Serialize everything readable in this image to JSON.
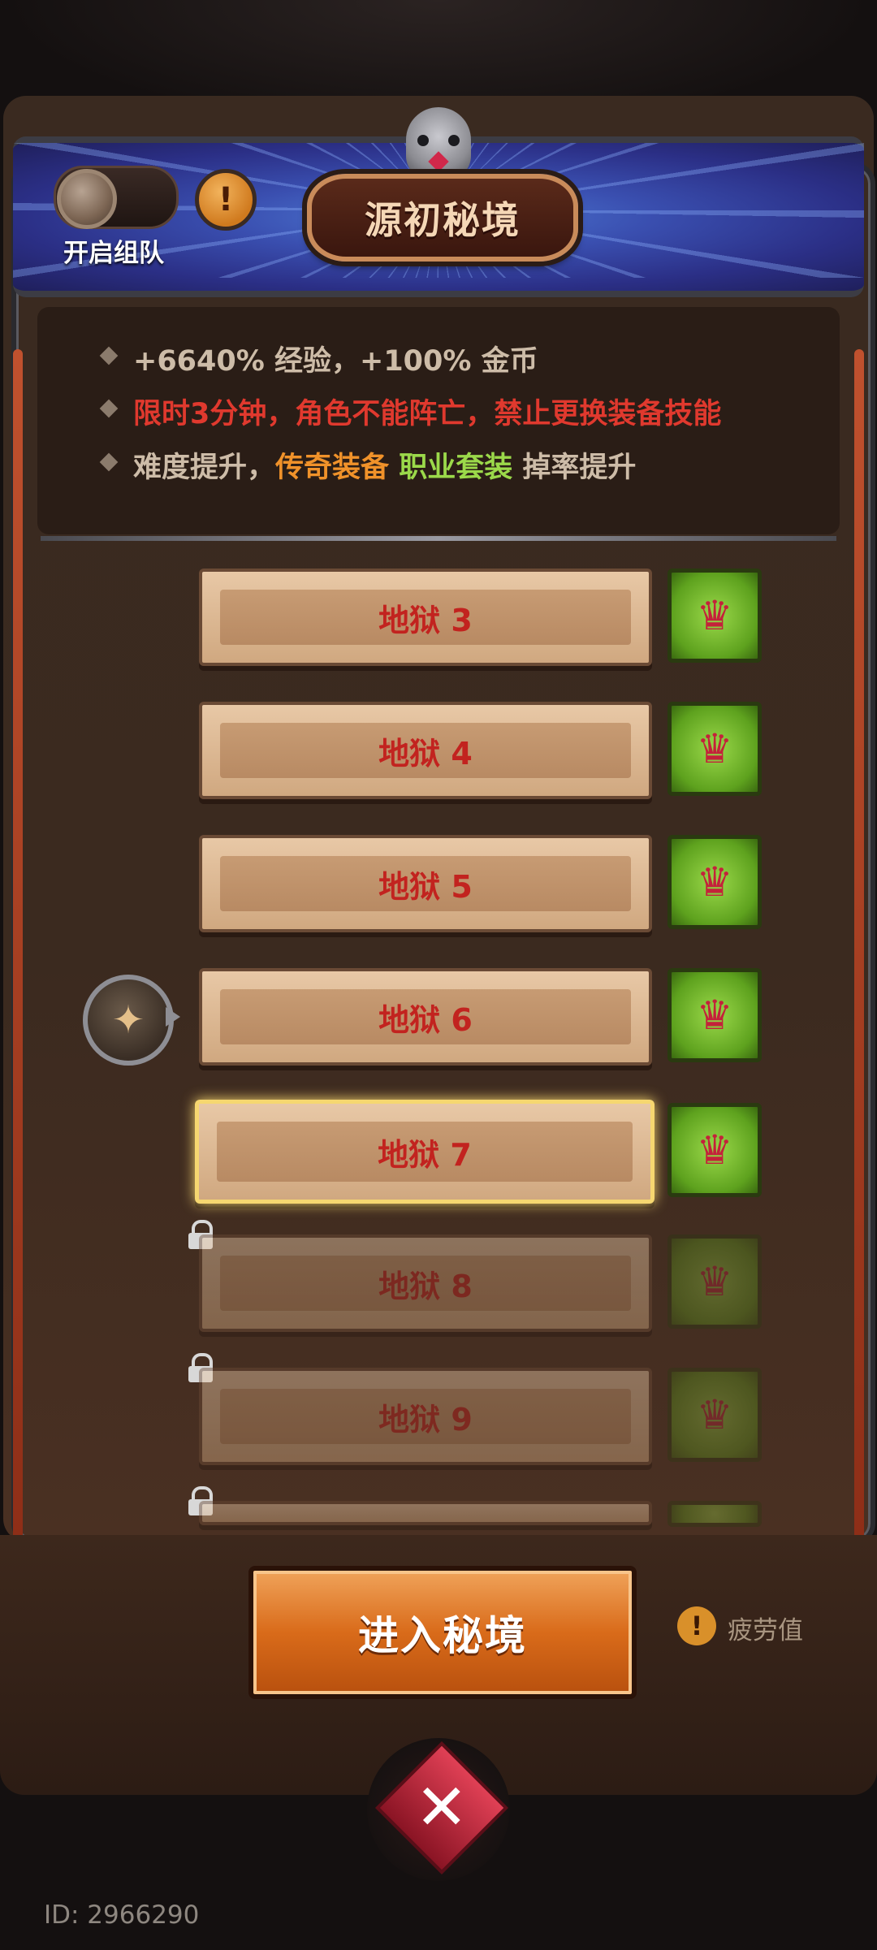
{
  "header": {
    "title": "源初秘境",
    "team_toggle_label": "开启组队",
    "team_info_icon": "!"
  },
  "info": {
    "line1": "+6640% 经验，+100% 金币",
    "line2": "限时3分钟，角色不能阵亡，禁止更换装备技能",
    "line3_prefix": "难度提升，",
    "line3_legendary": "传奇装备",
    "line3_set": "职业套装",
    "line3_suffix": "掉率提升"
  },
  "colors": {
    "line1": "#cdbca8",
    "line2": "#e0392e",
    "legendary": "#f0922a",
    "set": "#9bd94a",
    "neutral": "#cdbca8"
  },
  "levels": [
    {
      "label": "地狱 3",
      "state": "unlocked"
    },
    {
      "label": "地狱 4",
      "state": "unlocked"
    },
    {
      "label": "地狱 5",
      "state": "unlocked"
    },
    {
      "label": "地狱 6",
      "state": "current"
    },
    {
      "label": "地狱 7",
      "state": "selected"
    },
    {
      "label": "地狱 8",
      "state": "locked"
    },
    {
      "label": "地狱 9",
      "state": "locked"
    },
    {
      "label": "",
      "state": "locked"
    }
  ],
  "footer": {
    "enter_button": "进入秘境",
    "fatigue_icon": "!",
    "fatigue_label": "疲劳值",
    "player_id": "ID: 2966290"
  }
}
